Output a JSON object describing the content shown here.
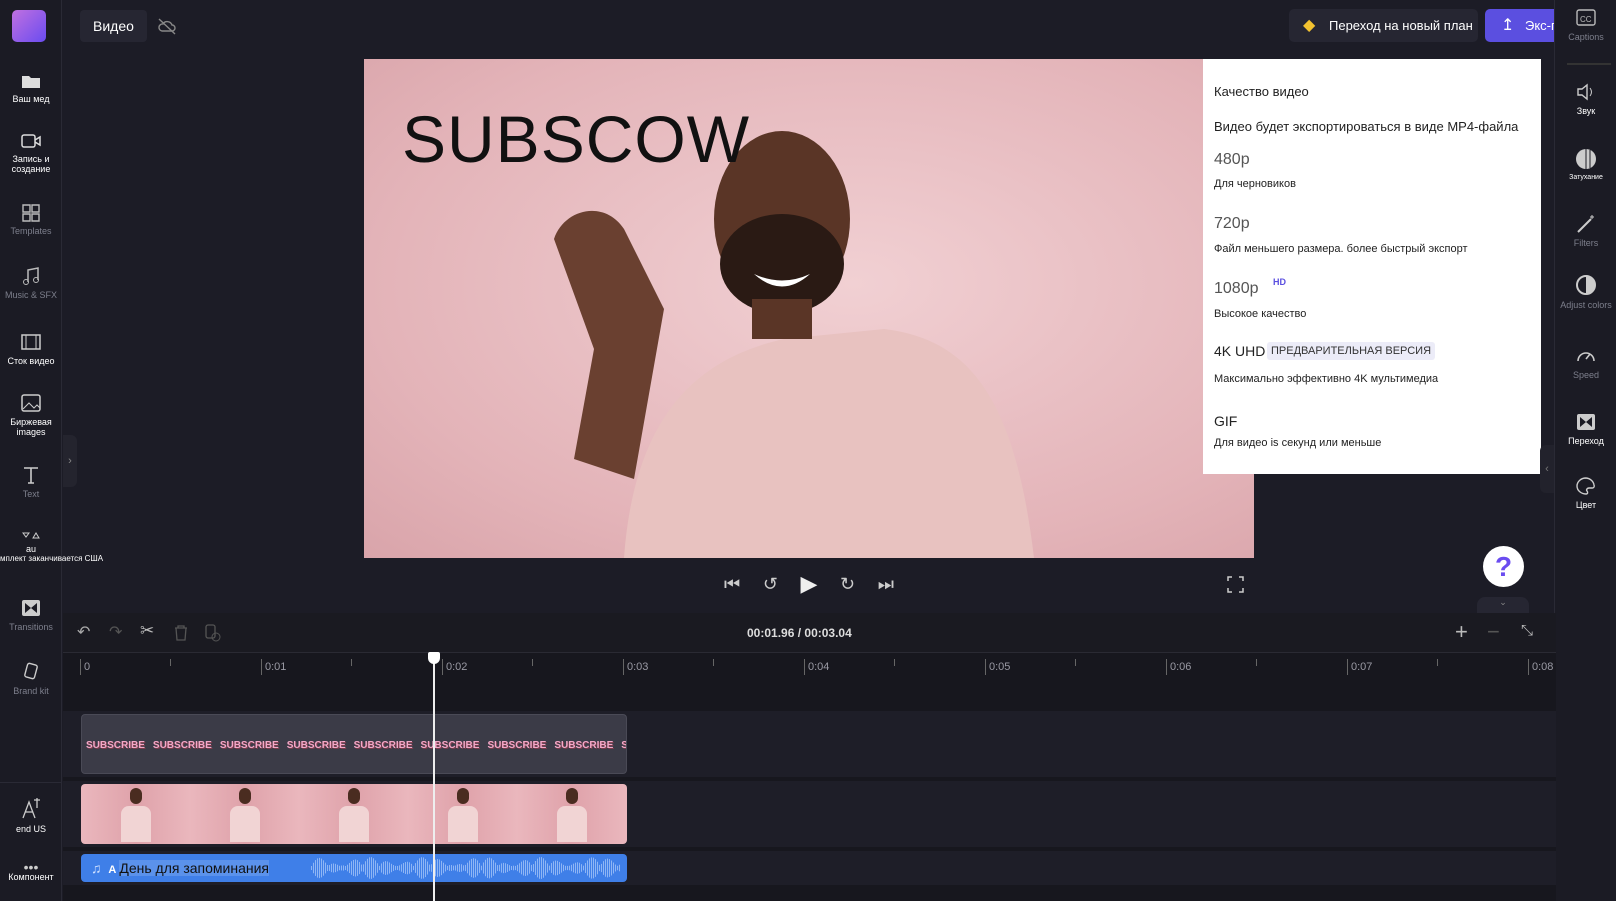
{
  "left_sidebar": {
    "items": [
      {
        "label": "Ваш мед",
        "icon": "folder-icon"
      },
      {
        "label": "Запись и создание",
        "icon": "camera-icon"
      },
      {
        "label": "Templates",
        "icon": "templates-icon"
      },
      {
        "label": "Music & SFX",
        "icon": "music-icon"
      },
      {
        "label": "Сток видео",
        "icon": "film-icon"
      },
      {
        "label": "Биржевая images",
        "icon": "image-icon"
      },
      {
        "label": "Text",
        "icon": "text-icon"
      },
      {
        "label": "au",
        "sublabel": "мплект заканчивается США",
        "icon": "shapes-icon"
      },
      {
        "label": "Transitions",
        "icon": "transitions-icon"
      },
      {
        "label": "Brand kit",
        "icon": "brand-kit-icon"
      },
      {
        "label": "end US",
        "icon": "translate-icon"
      },
      {
        "label": "Компонент",
        "icon": "more-icon"
      }
    ]
  },
  "topbar": {
    "tab": "Видео",
    "upgrade": "Переход на новый план",
    "export": "Экс-порт"
  },
  "preview": {
    "overlay_text": "SUBSCOW"
  },
  "export_menu": {
    "heading": "Качество видео",
    "note": "Видео будет экспортироваться в виде MP4-файла",
    "options": [
      {
        "label": "480p",
        "desc": "Для черновиков"
      },
      {
        "label": "720p",
        "desc": "Файл меньшего размера. более быстрый экспорт"
      },
      {
        "label": "1080p",
        "badge": "HD",
        "desc": "Высокое качество"
      },
      {
        "label": "4K UHD",
        "badge": "ПРЕДВАРИТЕЛЬНАЯ ВЕРСИЯ",
        "desc": "Максимально эффективно 4K мультимедиа"
      },
      {
        "label": "GIF",
        "desc": "Для видео is секунд или меньше"
      }
    ]
  },
  "right_sidebar": {
    "items": [
      {
        "label": "Captions",
        "icon": "captions-icon"
      },
      {
        "label": "Звук",
        "icon": "speaker-icon"
      },
      {
        "label": "Затухание",
        "icon": "fade-icon"
      },
      {
        "label": "Filters",
        "icon": "magic-wand-icon"
      },
      {
        "label": "Adjust colors",
        "icon": "contrast-icon"
      },
      {
        "label": "Speed",
        "icon": "speedometer-icon"
      },
      {
        "label": "Переход",
        "icon": "transition-icon"
      },
      {
        "label": "Цвет",
        "icon": "palette-icon"
      }
    ]
  },
  "timeline": {
    "current": "00:01.96",
    "total": "00:03.04",
    "separator": "/",
    "ruler": [
      "0",
      "0:01",
      "0:02",
      "0:03",
      "0:04",
      "0:05",
      "0:06",
      "0:07",
      "0:08"
    ],
    "text_clip": "SUBSCRIBE",
    "audio_clip": "День для запоминания",
    "audio_prefix": "A"
  },
  "colors": {
    "accent": "#5b4fe0",
    "audio": "#3f7fe8",
    "bg": "#1c1c26"
  }
}
